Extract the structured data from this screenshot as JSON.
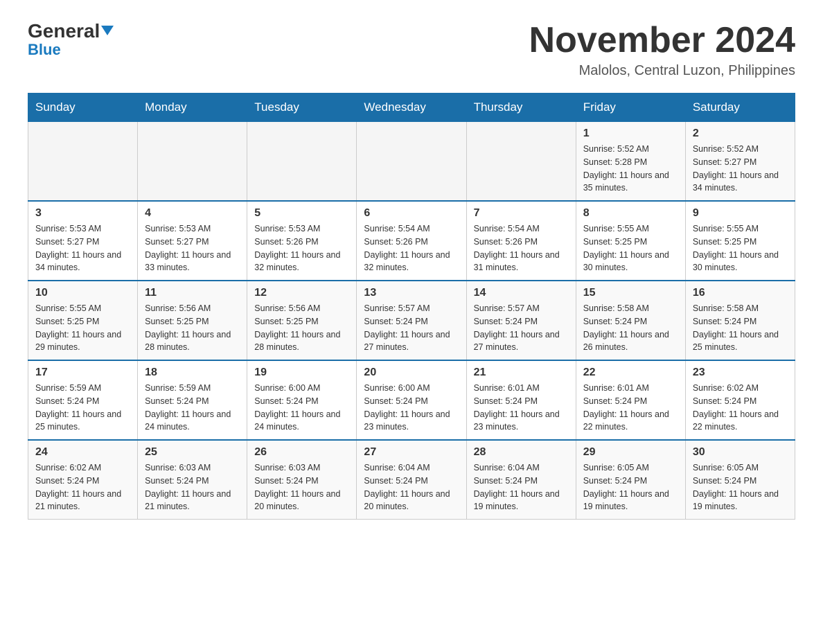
{
  "header": {
    "logo_general": "General",
    "logo_blue": "Blue",
    "main_title": "November 2024",
    "subtitle": "Malolos, Central Luzon, Philippines"
  },
  "weekdays": [
    "Sunday",
    "Monday",
    "Tuesday",
    "Wednesday",
    "Thursday",
    "Friday",
    "Saturday"
  ],
  "weeks": [
    [
      {
        "day": "",
        "info": ""
      },
      {
        "day": "",
        "info": ""
      },
      {
        "day": "",
        "info": ""
      },
      {
        "day": "",
        "info": ""
      },
      {
        "day": "",
        "info": ""
      },
      {
        "day": "1",
        "info": "Sunrise: 5:52 AM\nSunset: 5:28 PM\nDaylight: 11 hours and 35 minutes."
      },
      {
        "day": "2",
        "info": "Sunrise: 5:52 AM\nSunset: 5:27 PM\nDaylight: 11 hours and 34 minutes."
      }
    ],
    [
      {
        "day": "3",
        "info": "Sunrise: 5:53 AM\nSunset: 5:27 PM\nDaylight: 11 hours and 34 minutes."
      },
      {
        "day": "4",
        "info": "Sunrise: 5:53 AM\nSunset: 5:27 PM\nDaylight: 11 hours and 33 minutes."
      },
      {
        "day": "5",
        "info": "Sunrise: 5:53 AM\nSunset: 5:26 PM\nDaylight: 11 hours and 32 minutes."
      },
      {
        "day": "6",
        "info": "Sunrise: 5:54 AM\nSunset: 5:26 PM\nDaylight: 11 hours and 32 minutes."
      },
      {
        "day": "7",
        "info": "Sunrise: 5:54 AM\nSunset: 5:26 PM\nDaylight: 11 hours and 31 minutes."
      },
      {
        "day": "8",
        "info": "Sunrise: 5:55 AM\nSunset: 5:25 PM\nDaylight: 11 hours and 30 minutes."
      },
      {
        "day": "9",
        "info": "Sunrise: 5:55 AM\nSunset: 5:25 PM\nDaylight: 11 hours and 30 minutes."
      }
    ],
    [
      {
        "day": "10",
        "info": "Sunrise: 5:55 AM\nSunset: 5:25 PM\nDaylight: 11 hours and 29 minutes."
      },
      {
        "day": "11",
        "info": "Sunrise: 5:56 AM\nSunset: 5:25 PM\nDaylight: 11 hours and 28 minutes."
      },
      {
        "day": "12",
        "info": "Sunrise: 5:56 AM\nSunset: 5:25 PM\nDaylight: 11 hours and 28 minutes."
      },
      {
        "day": "13",
        "info": "Sunrise: 5:57 AM\nSunset: 5:24 PM\nDaylight: 11 hours and 27 minutes."
      },
      {
        "day": "14",
        "info": "Sunrise: 5:57 AM\nSunset: 5:24 PM\nDaylight: 11 hours and 27 minutes."
      },
      {
        "day": "15",
        "info": "Sunrise: 5:58 AM\nSunset: 5:24 PM\nDaylight: 11 hours and 26 minutes."
      },
      {
        "day": "16",
        "info": "Sunrise: 5:58 AM\nSunset: 5:24 PM\nDaylight: 11 hours and 25 minutes."
      }
    ],
    [
      {
        "day": "17",
        "info": "Sunrise: 5:59 AM\nSunset: 5:24 PM\nDaylight: 11 hours and 25 minutes."
      },
      {
        "day": "18",
        "info": "Sunrise: 5:59 AM\nSunset: 5:24 PM\nDaylight: 11 hours and 24 minutes."
      },
      {
        "day": "19",
        "info": "Sunrise: 6:00 AM\nSunset: 5:24 PM\nDaylight: 11 hours and 24 minutes."
      },
      {
        "day": "20",
        "info": "Sunrise: 6:00 AM\nSunset: 5:24 PM\nDaylight: 11 hours and 23 minutes."
      },
      {
        "day": "21",
        "info": "Sunrise: 6:01 AM\nSunset: 5:24 PM\nDaylight: 11 hours and 23 minutes."
      },
      {
        "day": "22",
        "info": "Sunrise: 6:01 AM\nSunset: 5:24 PM\nDaylight: 11 hours and 22 minutes."
      },
      {
        "day": "23",
        "info": "Sunrise: 6:02 AM\nSunset: 5:24 PM\nDaylight: 11 hours and 22 minutes."
      }
    ],
    [
      {
        "day": "24",
        "info": "Sunrise: 6:02 AM\nSunset: 5:24 PM\nDaylight: 11 hours and 21 minutes."
      },
      {
        "day": "25",
        "info": "Sunrise: 6:03 AM\nSunset: 5:24 PM\nDaylight: 11 hours and 21 minutes."
      },
      {
        "day": "26",
        "info": "Sunrise: 6:03 AM\nSunset: 5:24 PM\nDaylight: 11 hours and 20 minutes."
      },
      {
        "day": "27",
        "info": "Sunrise: 6:04 AM\nSunset: 5:24 PM\nDaylight: 11 hours and 20 minutes."
      },
      {
        "day": "28",
        "info": "Sunrise: 6:04 AM\nSunset: 5:24 PM\nDaylight: 11 hours and 19 minutes."
      },
      {
        "day": "29",
        "info": "Sunrise: 6:05 AM\nSunset: 5:24 PM\nDaylight: 11 hours and 19 minutes."
      },
      {
        "day": "30",
        "info": "Sunrise: 6:05 AM\nSunset: 5:24 PM\nDaylight: 11 hours and 19 minutes."
      }
    ]
  ]
}
